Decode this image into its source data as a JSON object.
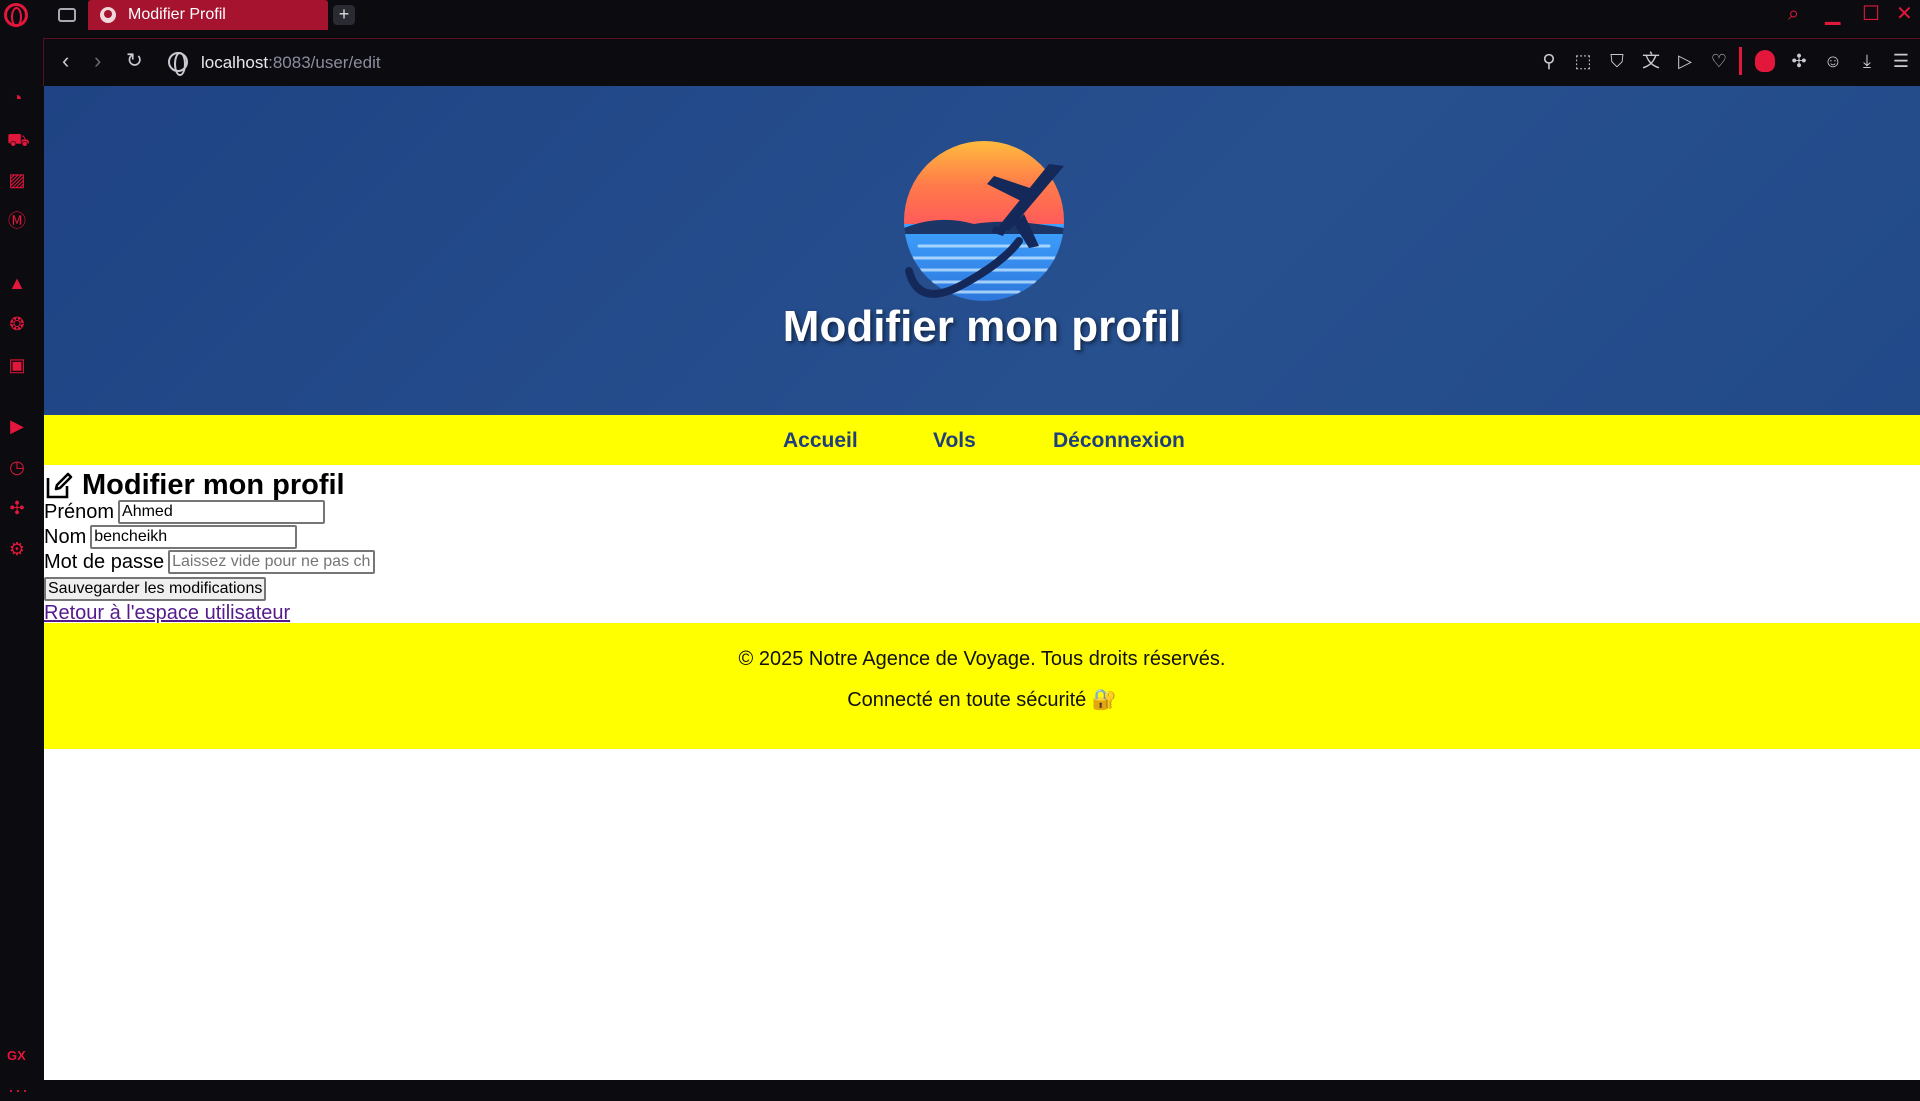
{
  "browser": {
    "tab_title": "Modifier Profil",
    "new_tab_symbol": "+",
    "url_host": "localhost",
    "url_rest": ":8083/user/edit",
    "sidebar_gx_label": "GX"
  },
  "hero": {
    "title": "Modifier mon profil"
  },
  "nav": {
    "items": [
      "Accueil",
      "Vols",
      "Déconnexion"
    ]
  },
  "form": {
    "heading": "Modifier mon profil",
    "prenom_label": "Prénom",
    "prenom_value": "Ahmed",
    "nom_label": "Nom",
    "nom_value": "bencheikh",
    "password_label": "Mot de passe",
    "password_placeholder": "Laissez vide pour ne pas changer",
    "save_label": "Sauvegarder les modifications",
    "back_link": "Retour à l'espace utilisateur"
  },
  "footer": {
    "copyright": "© 2025 Notre Agence de Voyage. Tous droits réservés.",
    "secure_text": "Connecté en toute sécurité 🔐"
  },
  "colors": {
    "browser_accent": "#e3173b",
    "hero_bg": "#254b8b",
    "nav_bg": "#ffff00",
    "nav_link": "#1f3f7c",
    "visited_link": "#551a8b"
  }
}
